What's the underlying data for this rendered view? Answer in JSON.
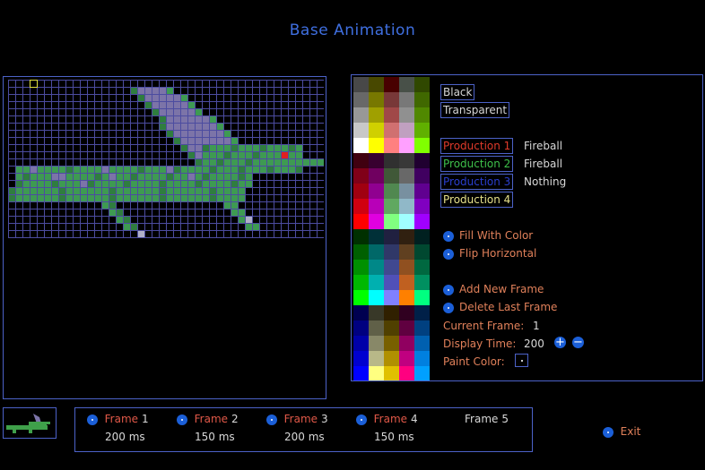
{
  "title": "Base Animation",
  "colors": {
    "accent": "#4c62c8",
    "title": "#3f6fe0",
    "option_text": "#e0805a",
    "frame_text": "#e05848"
  },
  "palette": {
    "black_label": "Black",
    "transparent_label": "Transparent"
  },
  "productions": [
    {
      "label": "Production 1",
      "value": "Fireball",
      "color": "#e03a2a"
    },
    {
      "label": "Production 2",
      "value": "Fireball",
      "color": "#3ec04a"
    },
    {
      "label": "Production 3",
      "value": "Nothing",
      "color": "#2a3fd0"
    },
    {
      "label": "Production 4",
      "value": "",
      "color": "#e6e08a"
    }
  ],
  "tools": {
    "fill": "Fill With Color",
    "flip": "Flip Horizontal",
    "add_frame": "Add New Frame",
    "delete_frame": "Delete Last Frame",
    "current_frame_label": "Current Frame:",
    "current_frame_value": "1",
    "display_time_label": "Display Time:",
    "display_time_value": "200",
    "plus": "+",
    "minus": "−",
    "paint_color_label": "Paint Color:"
  },
  "frames": [
    {
      "name": "Frame",
      "num": "1",
      "time": "200  ms"
    },
    {
      "name": "Frame",
      "num": "2",
      "time": "150  ms"
    },
    {
      "name": "Frame",
      "num": "3",
      "time": "200  ms"
    },
    {
      "name": "Frame",
      "num": "4",
      "time": "150  ms"
    },
    {
      "name": "Frame",
      "num": "5",
      "time": ""
    }
  ],
  "exit_label": "Exit"
}
